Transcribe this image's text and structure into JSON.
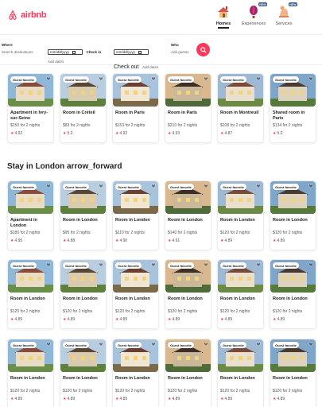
{
  "brand": {
    "name": "airbnb",
    "color": "#ff385c"
  },
  "nav": [
    {
      "label": "Homes",
      "icon": "house-icon",
      "active": true
    },
    {
      "label": "Experiences",
      "icon": "balloon-icon",
      "badge": "NEW"
    },
    {
      "label": "Services",
      "icon": "bell-service-icon",
      "badge": "NEW"
    }
  ],
  "search": {
    "where_label": "Where",
    "where_placeholder": "Search destinations",
    "checkin_value": "mm/dd/yyyy",
    "checkin_label": "Check in",
    "checkin_sub": "Add dates",
    "checkout_value": "mm/dd/yyyy",
    "checkout_label": "Check out",
    "checkout_sub": "Add dates",
    "who_label": "Who",
    "who_placeholder": "Add guests"
  },
  "badge_text": "Guest favorite",
  "row1": [
    {
      "title": "Apartment in Ivry-sur-Seine",
      "price": "$150 for 2 nights",
      "rating": "4.92"
    },
    {
      "title": "Room in Créteil",
      "price": "$83 for 2 nights",
      "rating": "5.0"
    },
    {
      "title": "Room in Paris",
      "price": "$153 for 2 nights",
      "rating": "4.92"
    },
    {
      "title": "Room in Paris",
      "price": "$210 for 2 nights",
      "rating": "4.93"
    },
    {
      "title": "Room in Montreuil",
      "price": "$108 for 2 nights",
      "rating": "4.87"
    },
    {
      "title": "Shared room in Paris",
      "price": "$134 for 2 nights",
      "rating": "5.0"
    }
  ],
  "section2_title": "Stay in London arrow_forward",
  "row2": [
    {
      "title": "Apartment in London",
      "price": "$180 for 2 nights",
      "rating": "4.95"
    },
    {
      "title": "Room in London",
      "price": "$95 for 2 nights",
      "rating": "4.88"
    },
    {
      "title": "Room in London",
      "price": "$110 for 2 nights",
      "rating": "4.90"
    },
    {
      "title": "Room in London",
      "price": "$140 for 2 nights",
      "rating": "4.91"
    },
    {
      "title": "Room in London",
      "price": "$120 for 2 nights",
      "rating": "4.89"
    },
    {
      "title": "Room in London",
      "price": "$120 for 2 nights",
      "rating": "4.89"
    }
  ],
  "row3": [
    {
      "title": "Room in London",
      "price": "$120 for 2 nights",
      "rating": "4.89"
    },
    {
      "title": "Room in London",
      "price": "$120 for 2 nights",
      "rating": "4.89"
    },
    {
      "title": "Room in London",
      "price": "$120 for 2 nights",
      "rating": "4.89"
    },
    {
      "title": "Room in London",
      "price": "$120 for 2 nights",
      "rating": "4.89"
    },
    {
      "title": "Room in London",
      "price": "$120 for 2 nights",
      "rating": "4.89"
    },
    {
      "title": "Room in London",
      "price": "$120 for 2 nights",
      "rating": "4.89"
    }
  ],
  "row4": [
    {
      "title": "Room in London",
      "price": "$120 for 2 nights",
      "rating": "4.89"
    },
    {
      "title": "Room in London",
      "price": "$120 for 2 nights",
      "rating": "4.89"
    },
    {
      "title": "Room in London",
      "price": "$120 for 2 nights",
      "rating": "4.89"
    },
    {
      "title": "Room in London",
      "price": "$120 for 2 nights",
      "rating": "4.89"
    },
    {
      "title": "Room in London",
      "price": "$120 for 2 nights",
      "rating": "4.89"
    },
    {
      "title": "Room in London",
      "price": "$120 for 2 nights",
      "rating": "4.89"
    }
  ]
}
